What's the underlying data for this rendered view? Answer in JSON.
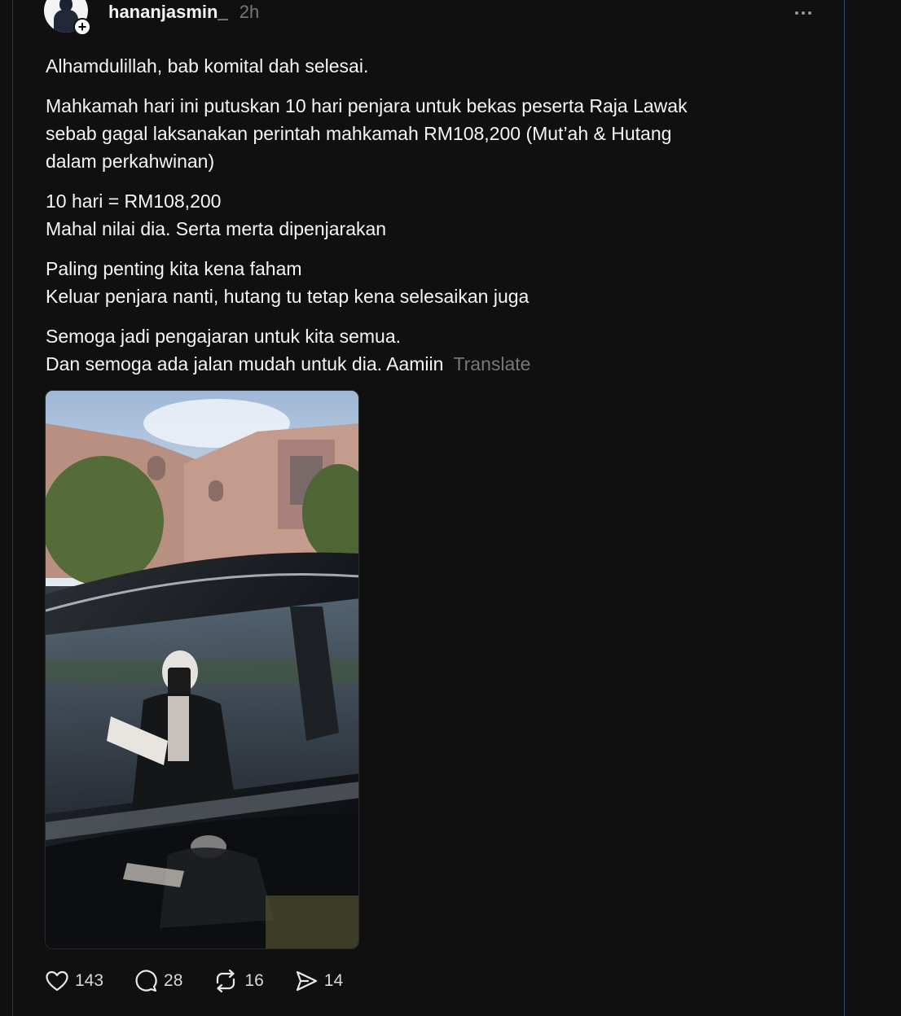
{
  "post": {
    "username": "hananjasmin_",
    "time": "2h",
    "follow_glyph": "+",
    "paragraphs": [
      [
        "Alhamdulillah, bab komital dah selesai."
      ],
      [
        "Mahkamah hari ini putuskan 10 hari penjara untuk bekas peserta Raja Lawak",
        "sebab gagal laksanakan perintah mahkamah RM108,200 (Mut’ah & Hutang",
        "dalam perkahwinan)"
      ],
      [
        "10 hari = RM108,200",
        "Mahal nilai dia. Serta merta dipenjarakan"
      ],
      [
        "Paling penting kita kena faham",
        "Keluar penjara nanti, hutang tu tetap kena selesaikan juga"
      ],
      [
        "Semoga jadi pengajaran untuk kita semua.",
        "Dan semoga ada jalan mudah untuk dia. Aamiin"
      ]
    ],
    "translate_label": "Translate"
  },
  "actions": {
    "like_count": "143",
    "reply_count": "28",
    "repost_count": "16",
    "share_count": "14"
  },
  "icons": {
    "like": "heart-icon",
    "reply": "speech-bubble-icon",
    "repost": "repost-arrows-icon",
    "share": "send-arrow-icon",
    "more": "more-dots-icon"
  },
  "colors": {
    "background": "#101010",
    "text": "#f3f5f7",
    "muted": "#777777",
    "column_border": "#3a4a78"
  }
}
